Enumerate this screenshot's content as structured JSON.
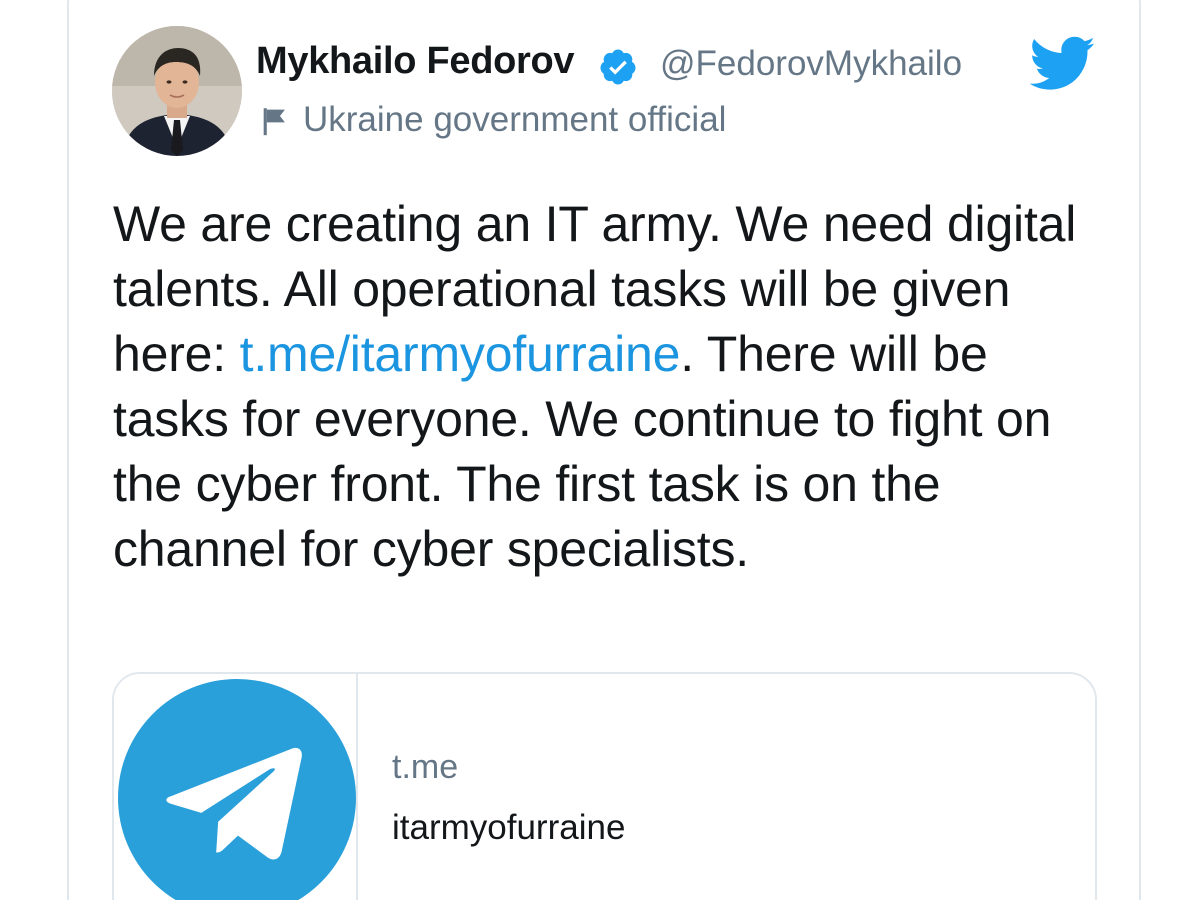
{
  "tweet": {
    "author": {
      "display_name": "Mykhailo Fedorov",
      "handle": "@FedorovMykhailo",
      "affiliation": "Ukraine government official",
      "verified": true
    },
    "text_parts": {
      "before_link": "We are creating an IT army. We need digital talents. All operational tasks will be given here: ",
      "link_text": "t.me/itarmyofurraine",
      "after_link": ". There will be tasks for everyone. We continue to fight on the cyber front. The first task is on the channel for cyber specialists."
    },
    "link_card": {
      "domain": "t.me",
      "title": "itarmyofurraine"
    }
  },
  "icons": {
    "verified": "verified-badge-icon",
    "brand": "twitter-bird-icon",
    "affiliation": "flag-icon",
    "card_image": "telegram-logo-icon"
  },
  "colors": {
    "twitter_blue": "#1da1f2",
    "link_blue": "#1b95e0",
    "telegram_blue": "#2aa0da",
    "text_primary": "#14171a",
    "text_secondary": "#657786",
    "border": "#e1e8ed"
  }
}
